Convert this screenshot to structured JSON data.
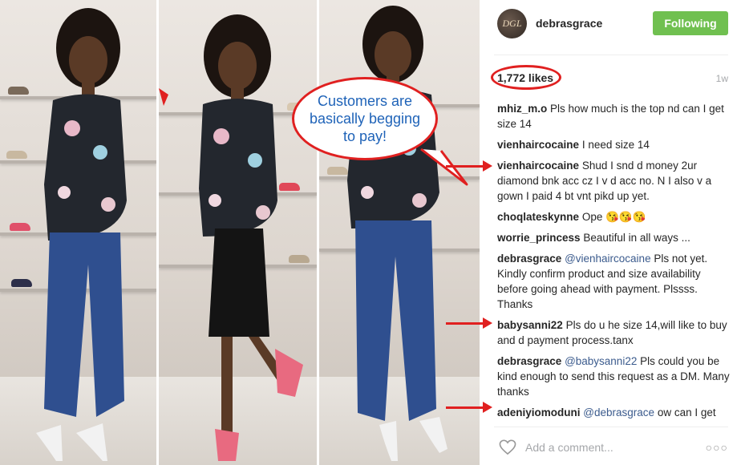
{
  "post": {
    "username": "debrasgrace",
    "avatar_initials": "DGL",
    "follow_label": "Following",
    "likes": "1,772 likes",
    "time": "1w",
    "add_comment_placeholder": "Add a comment...",
    "more_label": "○○○"
  },
  "annotation": {
    "bubble_text": "Customers are basically begging to pay!"
  },
  "comments": [
    {
      "user": "mhiz_m.o",
      "mention": "",
      "text": "Pls how much is the top nd can I get size 14"
    },
    {
      "user": "vienhaircocaine",
      "mention": "",
      "text": "I need size 14"
    },
    {
      "user": "vienhaircocaine",
      "mention": "",
      "text": "Shud I snd d money 2ur diamond bnk acc cz I v d acc no. N I also v a gown I paid 4 bt vnt pikd up yet."
    },
    {
      "user": "choqlateskynne",
      "mention": "",
      "text": "Ope 😘😘😘"
    },
    {
      "user": "worrie_princess",
      "mention": "",
      "text": "Beautiful in all ways ..."
    },
    {
      "user": "debrasgrace",
      "mention": "@vienhaircocaine",
      "text": "Pls not yet. Kindly confirm product and size availability before going ahead with payment. Plssss. Thanks"
    },
    {
      "user": "babysanni22",
      "mention": "",
      "text": "Pls do u he size 14,will like to buy and d payment process.tanx"
    },
    {
      "user": "debrasgrace",
      "mention": "@babysanni22",
      "text": "Pls could you be kind enough to send this request as a DM. Many thanks"
    },
    {
      "user": "adeniyiomoduni",
      "mention": "@debrasgrace",
      "text": "ow can I get dis top?am in uk."
    }
  ],
  "icons": {
    "heart": "heart-icon",
    "more": "more-options-icon"
  },
  "colors": {
    "follow_button": "#70c050",
    "annotation_red": "#e02020",
    "bubble_text": "#1f63b8",
    "mention": "#3b5b8d"
  }
}
